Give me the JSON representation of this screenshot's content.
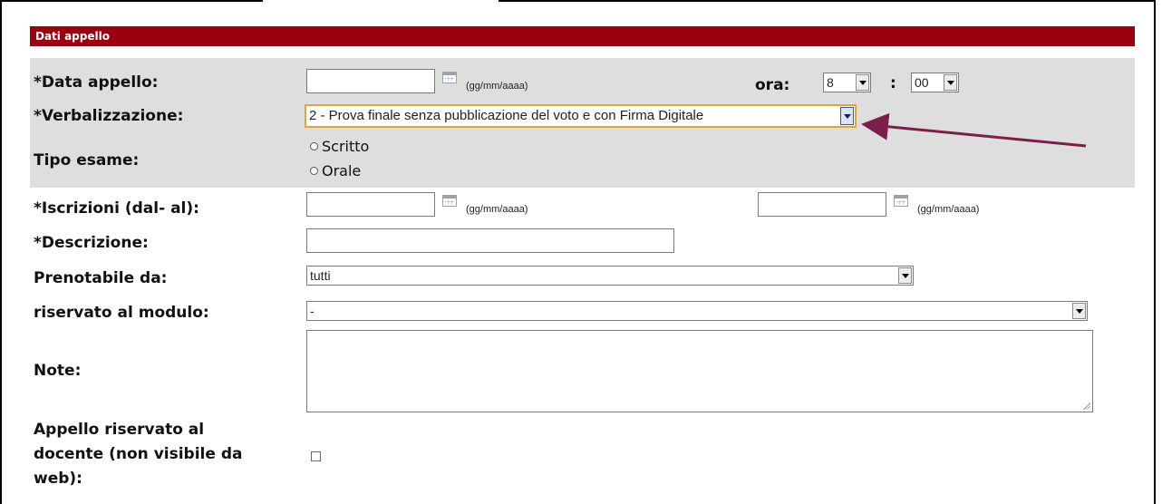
{
  "section_title": "Dati appello",
  "data_appello": {
    "label": "*Data appello:",
    "value": "",
    "hint": "(gg/mm/aaaa)"
  },
  "ora": {
    "label": "ora:",
    "hour": "8",
    "separator": ":",
    "minute": "00"
  },
  "verbalizzazione": {
    "label": "*Verbalizzazione:",
    "selected": "2 - Prova finale senza pubblicazione del voto e con Firma Digitale"
  },
  "tipo_esame": {
    "label": "Tipo esame:",
    "options": [
      "Scritto",
      "Orale"
    ]
  },
  "iscrizioni": {
    "label": "*Iscrizioni (dal- al):",
    "from_value": "",
    "to_value": "",
    "hint": "(gg/mm/aaaa)"
  },
  "descrizione": {
    "label": "*Descrizione:",
    "value": ""
  },
  "prenotabile": {
    "label": "Prenotabile da:",
    "selected": "tutti"
  },
  "riservato_modulo": {
    "label": "riservato al modulo:",
    "selected": "-"
  },
  "note": {
    "label": "Note:",
    "value": ""
  },
  "riservato_docente": {
    "label": "Appello riservato al docente (non visibile da web):",
    "checked": false
  },
  "colors": {
    "header_bg": "#9b0010",
    "band_bg": "#dedede",
    "highlight_border": "#e3a23a",
    "annotation_arrow": "#7a1f4a"
  }
}
